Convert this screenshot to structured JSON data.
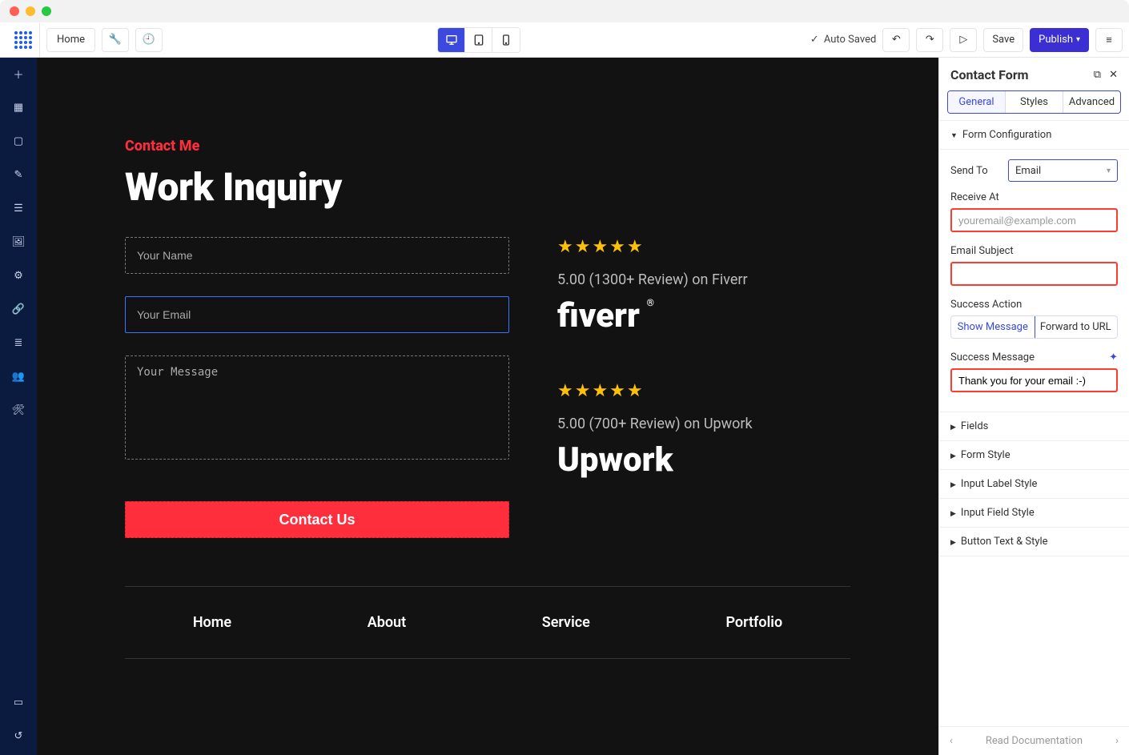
{
  "toolbar": {
    "home_label": "Home",
    "auto_saved_label": "Auto Saved",
    "save_label": "Save",
    "publish_label": "Publish"
  },
  "canvas": {
    "eyebrow": "Contact Me",
    "heading": "Work Inquiry",
    "form": {
      "name_placeholder": "Your Name",
      "email_placeholder": "Your Email",
      "message_placeholder": "Your Message",
      "submit_label": "Contact Us"
    },
    "reviews": [
      {
        "rating_text": "5.00 (1300+ Review) on Fiverr",
        "brand": "fiverr"
      },
      {
        "rating_text": "5.00 (700+ Review) on Upwork",
        "brand": "Upwork"
      }
    ],
    "footer_nav": [
      "Home",
      "About",
      "Service",
      "Portfolio"
    ]
  },
  "panel": {
    "title": "Contact Form",
    "tabs": {
      "general": "General",
      "styles": "Styles",
      "advanced": "Advanced"
    },
    "sections": {
      "form_config": "Form Configuration",
      "fields": "Fields",
      "form_style": "Form Style",
      "input_label_style": "Input Label Style",
      "input_field_style": "Input Field Style",
      "button_text_style": "Button Text & Style"
    },
    "form_config": {
      "send_to_label": "Send To",
      "send_to_value": "Email",
      "receive_at_label": "Receive At",
      "receive_at_placeholder": "youremail@example.com",
      "receive_at_value": "",
      "email_subject_label": "Email Subject",
      "email_subject_value": "",
      "success_action_label": "Success Action",
      "success_action_options": {
        "show_message": "Show Message",
        "forward_url": "Forward to URL"
      },
      "success_message_label": "Success Message",
      "success_message_value": "Thank you for your email :-)"
    },
    "footer_doc": "Read Documentation"
  }
}
